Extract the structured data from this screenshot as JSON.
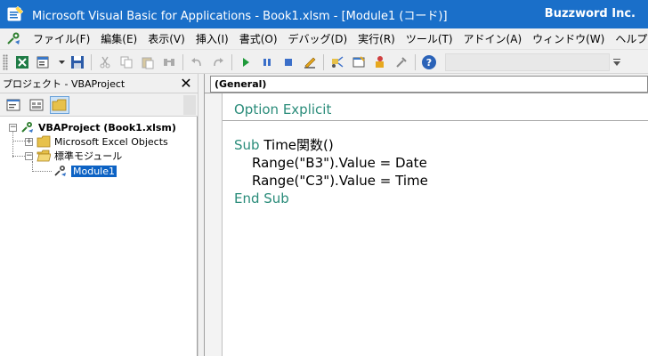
{
  "window": {
    "title": "Microsoft Visual Basic for Applications - Book1.xlsm - [Module1 (コード)]",
    "brand": "Buzzword Inc."
  },
  "menu": {
    "items": [
      {
        "label": "ファイル(F)"
      },
      {
        "label": "編集(E)"
      },
      {
        "label": "表示(V)"
      },
      {
        "label": "挿入(I)"
      },
      {
        "label": "書式(O)"
      },
      {
        "label": "デバッグ(D)"
      },
      {
        "label": "実行(R)"
      },
      {
        "label": "ツール(T)"
      },
      {
        "label": "アドイン(A)"
      },
      {
        "label": "ウィンドウ(W)"
      },
      {
        "label": "ヘルプ(H)"
      }
    ]
  },
  "project": {
    "title": "プロジェクト - VBAProject",
    "root": "VBAProject (Book1.xlsm)",
    "excel_objects": "Microsoft Excel Objects",
    "modules_folder": "標準モジュール",
    "module": "Module1"
  },
  "code": {
    "object_combo": "(General)",
    "option_kw": "Option Explicit",
    "sub_kw": "Sub",
    "sub_name": " Time関数()",
    "line1": "Range(\"B3\").Value = Date",
    "line2": "Range(\"C3\").Value = Time",
    "end_kw": "End Sub"
  },
  "colors": {
    "titlebar": "#1a6fc9",
    "keyword": "#2a8c7a",
    "selection": "#0c62c4"
  }
}
